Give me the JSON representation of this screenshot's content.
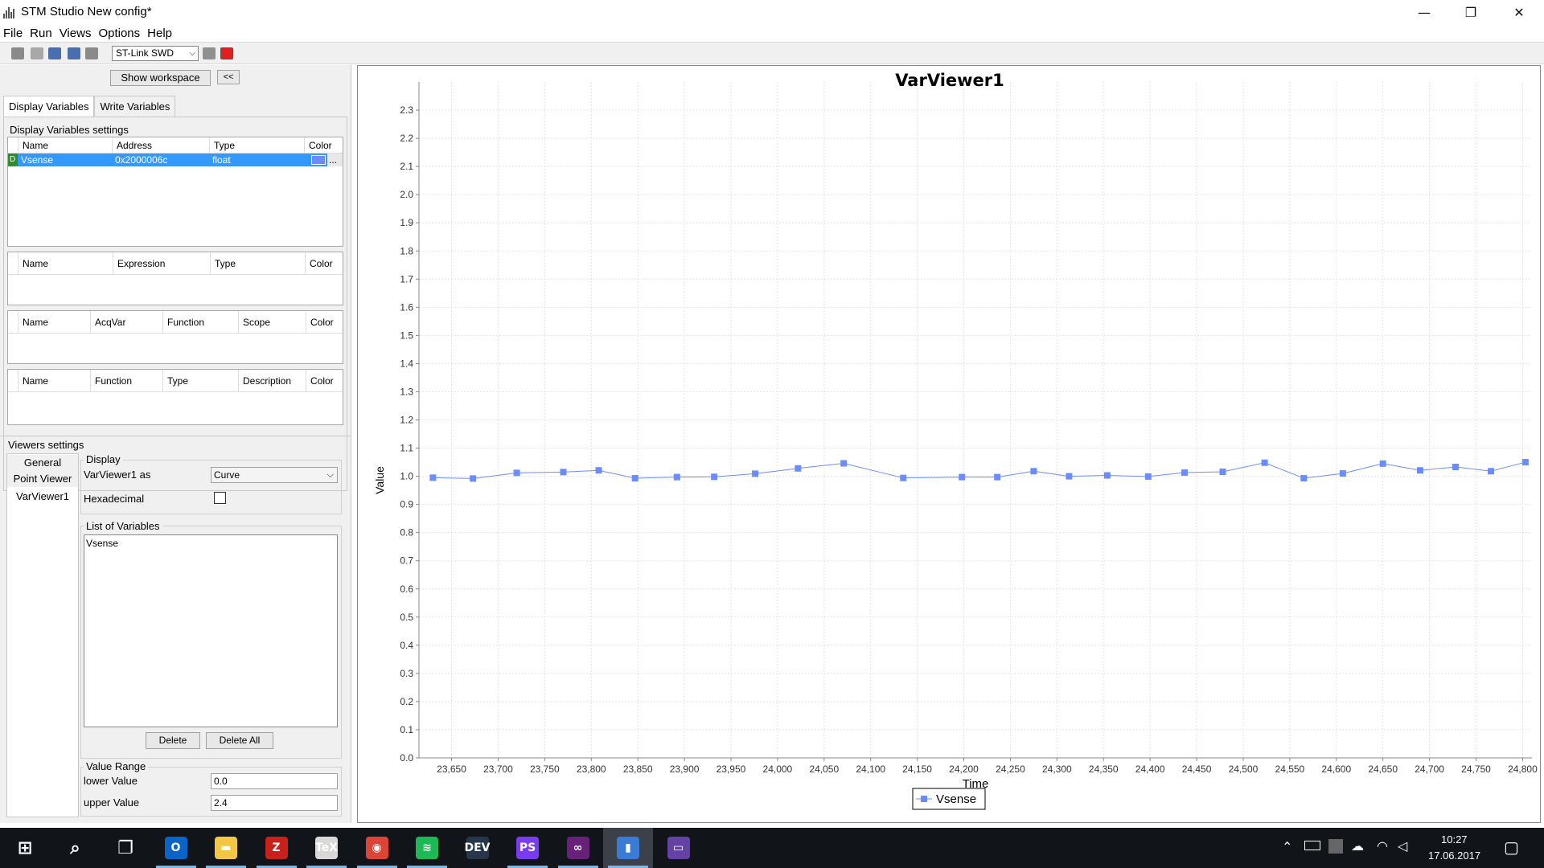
{
  "window": {
    "title": "STM Studio New config*",
    "minimize": "—",
    "maximize": "❐",
    "close": "✕"
  },
  "menu": [
    "File",
    "Run",
    "Views",
    "Options",
    "Help"
  ],
  "toolbar": {
    "probe": "ST-Link SWD",
    "icons": [
      "open-icon",
      "new-icon",
      "save-as-icon",
      "save-icon",
      "export-icon",
      "pause-icon",
      "stop-icon"
    ],
    "stop_color": "#e02020"
  },
  "left": {
    "show_workspace": "Show workspace",
    "collapse": "<<",
    "tabs": [
      "Display Variables",
      "Write Variables"
    ],
    "settings_title": "Display Variables settings",
    "var_table": {
      "headers": [
        "Name",
        "Address",
        "Type",
        "Color"
      ],
      "rows": [
        {
          "flag": "D",
          "name": "Vsense",
          "address": "0x2000006c",
          "type": "float",
          "color": "#6b8cff",
          "more": "..."
        }
      ]
    },
    "expr_table": {
      "headers": [
        "Name",
        "Expression",
        "Type",
        "Color"
      ]
    },
    "acq_table": {
      "headers": [
        "Name",
        "AcqVar",
        "Function",
        "Scope",
        "Color"
      ]
    },
    "func_table": {
      "headers": [
        "Name",
        "Function",
        "Type",
        "Description",
        "Color"
      ]
    }
  },
  "viewers": {
    "title": "Viewers settings",
    "list": [
      "General",
      "Point Viewer",
      "VarViewer1"
    ],
    "display_legend": "Display",
    "as_label": "VarViewer1 as",
    "as_value": "Curve",
    "hex_label": "Hexadecimal",
    "list_legend": "List of Variables",
    "variables": [
      "Vsense"
    ],
    "delete": "Delete",
    "delete_all": "Delete All",
    "range_legend": "Value Range",
    "lower_label": "lower Value",
    "lower_value": "0.0",
    "upper_label": "upper Value",
    "upper_value": "2.4"
  },
  "chart_data": {
    "type": "line",
    "title": "VarViewer1",
    "xlabel": "Time",
    "ylabel": "Value",
    "xlim": [
      23615,
      23810
    ],
    "ylim": [
      0.0,
      2.4
    ],
    "xticks": [
      23650,
      23700,
      23750,
      23800,
      23850,
      23900,
      23950,
      24000,
      24050,
      24100,
      24150,
      24200,
      24250,
      24300,
      24350,
      24400,
      24450,
      24500,
      24550,
      24600,
      24650,
      24700,
      24750,
      24800
    ],
    "xtick_labels": [
      "23,650",
      "23,700",
      "23,750",
      "23,800",
      "23,850",
      "23,900",
      "23,950",
      "24,000",
      "24,050",
      "24,100",
      "24,150",
      "24,200",
      "24,250",
      "24,300",
      "24,350",
      "24,400",
      "24,450",
      "24,500",
      "24,550",
      "24,600",
      "24,650",
      "24,700",
      "24,750",
      "24,800"
    ],
    "yticks": [
      "0.0",
      "0.1",
      "0.2",
      "0.3",
      "0.4",
      "0.5",
      "0.6",
      "0.7",
      "0.8",
      "0.9",
      "1.0",
      "1.1",
      "1.2",
      "1.3",
      "1.4",
      "1.5",
      "1.6",
      "1.7",
      "1.8",
      "1.9",
      "2.0",
      "2.1",
      "2.2",
      "2.3"
    ],
    "grid": true,
    "legend": "bottom-center",
    "series": [
      {
        "name": "Vsense",
        "color": "#6b8cff",
        "x": [
          23630,
          23673,
          23720,
          23770,
          23808,
          23847,
          23892,
          23932,
          23976,
          24022,
          24071,
          24135,
          24198,
          24236,
          24275,
          24313,
          24354,
          24398,
          24437,
          24478,
          24523,
          24565,
          24607,
          24650,
          24690,
          24728,
          24766,
          24803
        ],
        "values": [
          0.995,
          0.992,
          1.012,
          1.015,
          1.021,
          0.993,
          0.997,
          0.998,
          1.009,
          1.028,
          1.046,
          0.994,
          0.997,
          0.997,
          1.018,
          1.0,
          1.003,
          0.999,
          1.013,
          1.016,
          1.048,
          0.993,
          1.01,
          1.045,
          1.021,
          1.033,
          1.018,
          1.05
        ]
      }
    ]
  },
  "taskbar": {
    "apps": [
      {
        "name": "start-icon",
        "label": "⊞",
        "color": "transparent"
      },
      {
        "name": "search-icon",
        "label": "⌕",
        "color": "transparent"
      },
      {
        "name": "task-view-icon",
        "label": "❐",
        "color": "transparent"
      },
      {
        "name": "outlook-icon",
        "label": "O",
        "color": "#0a64c8"
      },
      {
        "name": "file-explorer-icon",
        "label": "▬",
        "color": "#f2c744"
      },
      {
        "name": "filezilla-icon",
        "label": "Z",
        "color": "#c8201a"
      },
      {
        "name": "tex-icon",
        "label": "TeX",
        "color": "#d8d8d8"
      },
      {
        "name": "chrome-icon",
        "label": "◉",
        "color": "#db4437"
      },
      {
        "name": "spotify-icon",
        "label": "≋",
        "color": "#1db954"
      },
      {
        "name": "devexpress-icon",
        "label": "DEV",
        "color": "#27364a"
      },
      {
        "name": "phpstorm-icon",
        "label": "PS",
        "color": "#7a3cf0"
      },
      {
        "name": "visual-studio-icon",
        "label": "∞",
        "color": "#68217a"
      },
      {
        "name": "stm-studio-icon",
        "label": "▮",
        "color": "#3a7bd5"
      },
      {
        "name": "twitch-icon",
        "label": "▭",
        "color": "#6441a4"
      }
    ],
    "time": "10:27",
    "date": "17.06.2017",
    "notification": "▢"
  }
}
